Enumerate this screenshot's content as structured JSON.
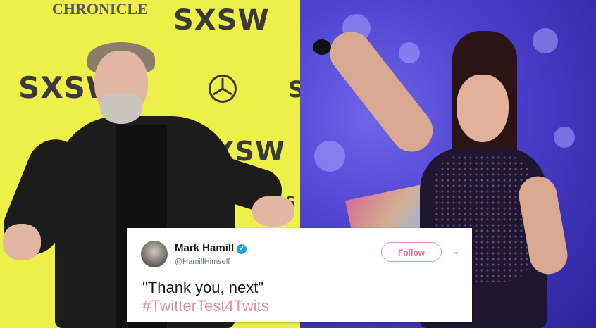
{
  "backdrop": {
    "chronicle": "CHRONICLE",
    "sxsw_1": "SXSW",
    "sxsw_2": "SXSW",
    "sxsw_3": "SXSW",
    "sxsw_4": "S",
    "sxsw_5": "S"
  },
  "tweet": {
    "author_name": "Mark Hamill",
    "handle": "@HamillHimself",
    "follow_label": "Follow",
    "text": "\"Thank you, next\"",
    "hashtag": "#TwitterTest4Twits"
  },
  "icons": {
    "verified": "verified-badge-icon",
    "caret": "chevron-down-icon",
    "mercedes": "mercedes-logo-icon"
  },
  "colors": {
    "backdrop_yellow": "#eef04a",
    "stage_purple": "#4d41d0",
    "follow_pink": "#e56b93",
    "hashtag_pink": "#e38bab",
    "verified_blue": "#1da1f2"
  }
}
